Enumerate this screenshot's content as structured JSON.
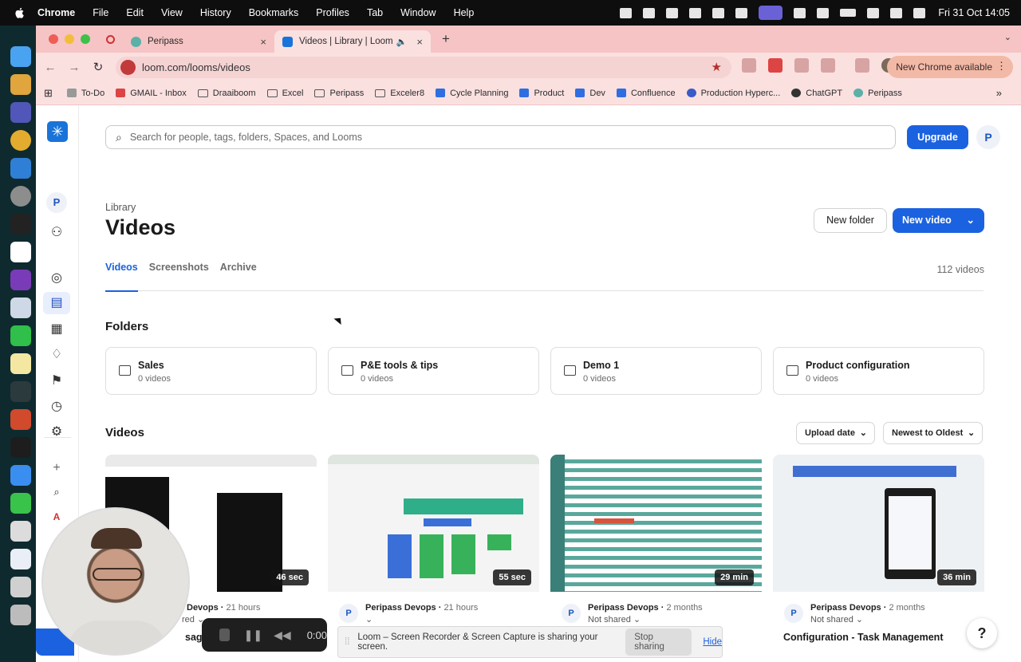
{
  "menubar": {
    "app": "Chrome",
    "items": [
      "File",
      "Edit",
      "View",
      "History",
      "Bookmarks",
      "Profiles",
      "Tab",
      "Window",
      "Help"
    ],
    "clock": "Fri 31 Oct  14:05"
  },
  "tabs": [
    {
      "title": "Peripass",
      "active": false
    },
    {
      "title": "Videos | Library | Loom",
      "active": true
    }
  ],
  "toolbar": {
    "url": "loom.com/looms/videos",
    "new_chrome": "New Chrome available"
  },
  "bookmarks": [
    "To-Do",
    "GMAIL - Inbox",
    "Draaiboom",
    "Excel",
    "Peripass",
    "Exceler8",
    "Cycle Planning",
    "Product",
    "Dev",
    "Confluence",
    "Production Hyperc...",
    "ChatGPT",
    "Peripass"
  ],
  "loom": {
    "search_placeholder": "Search for people, tags, folders, Spaces, and Looms",
    "upgrade": "Upgrade",
    "avatar": "P",
    "workspace": "P",
    "breadcrumb": "Library",
    "title": "Videos",
    "new_folder": "New folder",
    "new_video": "New video",
    "tabs": [
      "Videos",
      "Screenshots",
      "Archive"
    ],
    "count": "112 videos",
    "folders_heading": "Folders",
    "folders": [
      {
        "name": "Sales",
        "count": "0 videos"
      },
      {
        "name": "P&E tools & tips",
        "count": "0 videos"
      },
      {
        "name": "Demo 1",
        "count": "0 videos"
      },
      {
        "name": "Product configuration",
        "count": "0 videos"
      }
    ],
    "videos_heading": "Videos",
    "sort_by": "Upload date",
    "sort_order": "Newest to Oldest",
    "videos": [
      {
        "duration": "46 sec",
        "author": "Devops",
        "age": "21 hours",
        "shared": "red",
        "title": "sage - 3"
      },
      {
        "duration": "55 sec",
        "author": "Peripass Devops",
        "age": "21 hours",
        "shared": "",
        "title": ""
      },
      {
        "duration": "29 min",
        "author": "Peripass Devops",
        "age": "2 months",
        "shared": "Not shared",
        "title": ""
      },
      {
        "duration": "36 min",
        "author": "Peripass Devops",
        "age": "2 months",
        "shared": "Not shared",
        "title": "Configuration - Task Management"
      }
    ]
  },
  "recorder": {
    "time": "0:00"
  },
  "share_notice": {
    "text": "Loom – Screen Recorder & Screen Capture is sharing your screen.",
    "stop": "Stop sharing",
    "hide": "Hide"
  },
  "help": "?",
  "colors": {
    "accent": "#1b62e0",
    "tab_strip": "#f6c4c4",
    "toolbar": "#fbe0e0"
  }
}
